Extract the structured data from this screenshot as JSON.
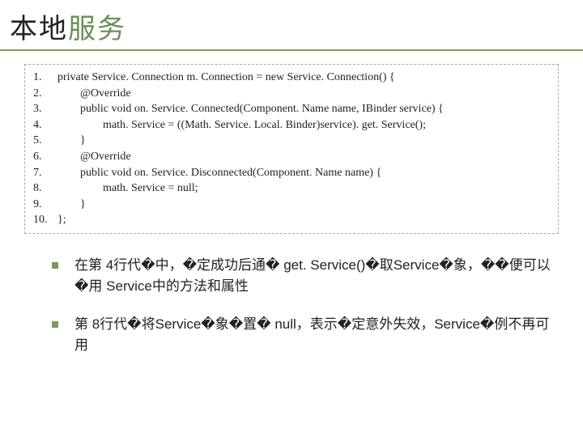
{
  "title": {
    "part1": "本地",
    "part2": "服务"
  },
  "code": {
    "lines": [
      {
        "n": "1.",
        "t": "private Service. Connection m. Connection = new Service. Connection() {"
      },
      {
        "n": "2.",
        "t": "        @Override"
      },
      {
        "n": "3.",
        "t": "        public void on. Service. Connected(Component. Name name, IBinder service) {"
      },
      {
        "n": "4.",
        "t": "                math. Service = ((Math. Service. Local. Binder)service). get. Service();"
      },
      {
        "n": "5.",
        "t": "        }"
      },
      {
        "n": "6.",
        "t": "        @Override"
      },
      {
        "n": "7.",
        "t": "        public void on. Service. Disconnected(Component. Name name) {"
      },
      {
        "n": "8.",
        "t": "                math. Service = null;"
      },
      {
        "n": "9.",
        "t": "        }"
      },
      {
        "n": "10.",
        "t": "};"
      }
    ]
  },
  "bullets": [
    "在第 4行代�中，�定成功后通� get. Service()�取Service�象，��便可以�用 Service中的方法和属性",
    "第 8行代�将Service�象�置� null，表示�定意外失效，Service�例不再可用"
  ]
}
